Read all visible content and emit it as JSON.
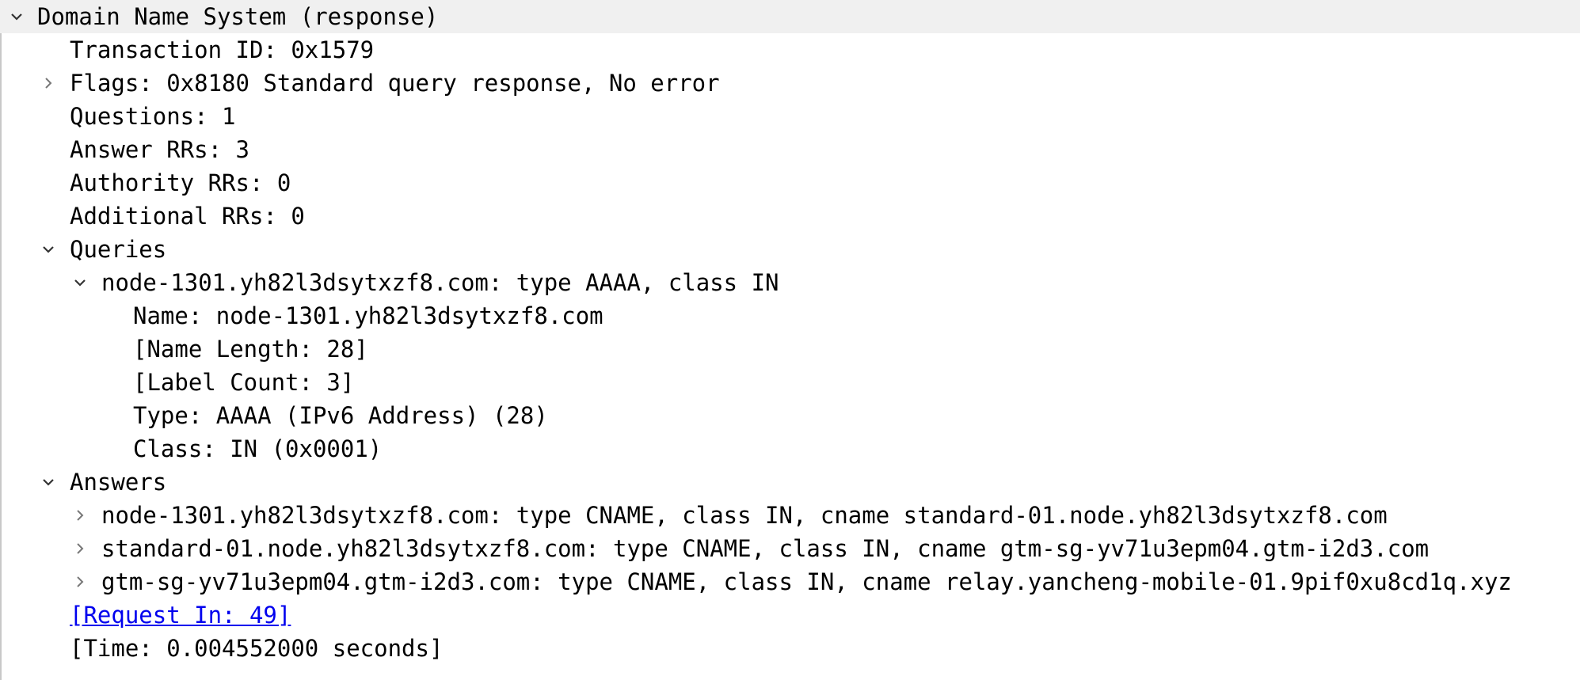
{
  "tree": {
    "dns_header": "Domain Name System (response)",
    "transaction_id": "Transaction ID: 0x1579",
    "flags": "Flags: 0x8180 Standard query response, No error",
    "questions": "Questions: 1",
    "answer_rrs": "Answer RRs: 3",
    "authority_rrs": "Authority RRs: 0",
    "additional_rrs": "Additional RRs: 0",
    "queries_header": "Queries",
    "query": {
      "summary": "node-1301.yh82l3dsytxzf8.com: type AAAA, class IN",
      "name": "Name: node-1301.yh82l3dsytxzf8.com",
      "name_length": "[Name Length: 28]",
      "label_count": "[Label Count: 3]",
      "type": "Type: AAAA (IPv6 Address) (28)",
      "class": "Class: IN (0x0001)"
    },
    "answers_header": "Answers",
    "answers": [
      "node-1301.yh82l3dsytxzf8.com: type CNAME, class IN, cname standard-01.node.yh82l3dsytxzf8.com",
      "standard-01.node.yh82l3dsytxzf8.com: type CNAME, class IN, cname gtm-sg-yv71u3epm04.gtm-i2d3.com",
      "gtm-sg-yv71u3epm04.gtm-i2d3.com: type CNAME, class IN, cname relay.yancheng-mobile-01.9pif0xu8cd1q.xyz"
    ],
    "request_in": "[Request In: 49]",
    "time": "[Time: 0.004552000 seconds]"
  },
  "colors": {
    "header_bg": "#f0f0f0",
    "link": "#0000ee",
    "chevron": "#555555"
  }
}
